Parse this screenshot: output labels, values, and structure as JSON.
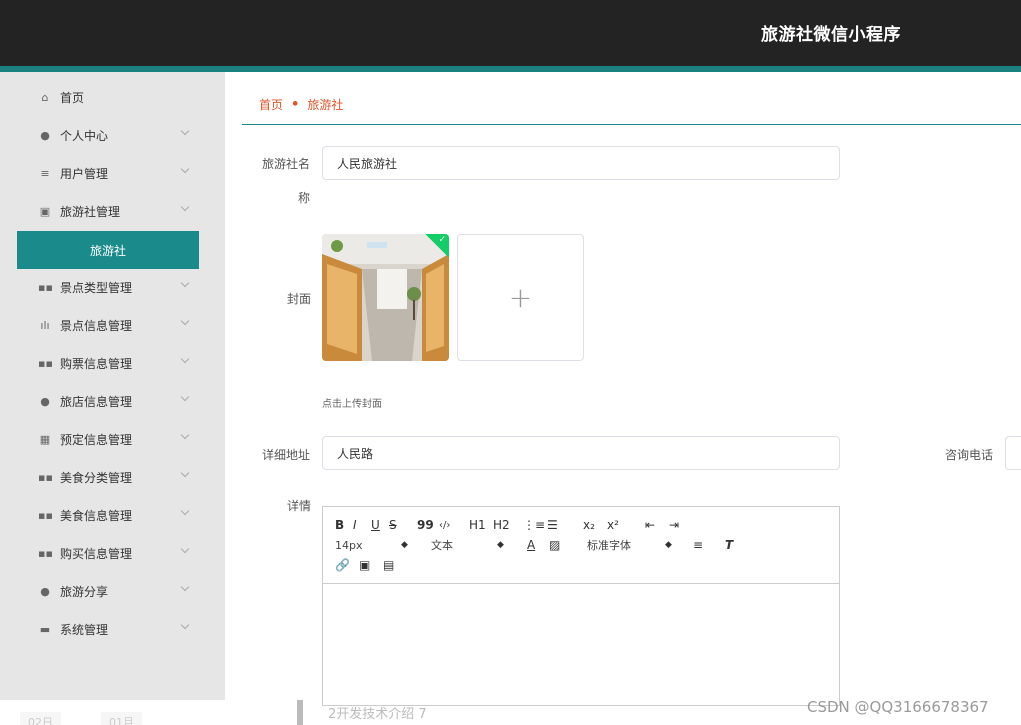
{
  "header": {
    "title": "旅游社微信小程序"
  },
  "sidebar": {
    "items": [
      {
        "label": "首页",
        "icon": "⌂",
        "chevron": false
      },
      {
        "label": "个人中心",
        "icon": "●",
        "chevron": true
      },
      {
        "label": "用户管理",
        "icon": "≡",
        "chevron": true
      },
      {
        "label": "旅游社管理",
        "icon": "▣",
        "chevron": true
      },
      {
        "label": "景点类型管理",
        "icon": "▪▪",
        "chevron": true
      },
      {
        "label": "景点信息管理",
        "icon": "ılı",
        "chevron": true
      },
      {
        "label": "购票信息管理",
        "icon": "▪▪",
        "chevron": true
      },
      {
        "label": "旅店信息管理",
        "icon": "●",
        "chevron": true
      },
      {
        "label": "预定信息管理",
        "icon": "▦",
        "chevron": true
      },
      {
        "label": "美食分类管理",
        "icon": "▪▪",
        "chevron": true
      },
      {
        "label": "美食信息管理",
        "icon": "▪▪",
        "chevron": true
      },
      {
        "label": "购买信息管理",
        "icon": "▪▪",
        "chevron": true
      },
      {
        "label": "旅游分享",
        "icon": "●",
        "chevron": true
      },
      {
        "label": "系统管理",
        "icon": "▬",
        "chevron": true
      }
    ],
    "active_sub": "旅游社"
  },
  "breadcrumb": {
    "home": "首页",
    "current": "旅游社"
  },
  "form": {
    "name_label_1": "旅游社名",
    "name_label_2": "称",
    "name_value": "人民旅游社",
    "cover_label": "封面",
    "cover_hint": "点击上传封面",
    "address_label": "详细地址",
    "address_value": "人民路",
    "phone_label": "咨询电话",
    "detail_label": "详情"
  },
  "editor": {
    "row1": [
      "B",
      "I",
      "U",
      "S",
      "99",
      "‹/›",
      "H1",
      "H2",
      "⋮≡",
      "☰",
      "x₂",
      "x²",
      "⇤",
      "⇥"
    ],
    "font_size": "14px",
    "format": "文本",
    "font_family": "标准字体",
    "row3": [
      "🔗",
      "▣",
      "▤"
    ]
  },
  "footer": {
    "text": "2开发技术介绍 7",
    "watermark": "CSDN @QQ3166678367",
    "tabs": [
      "02日",
      "01月"
    ]
  }
}
